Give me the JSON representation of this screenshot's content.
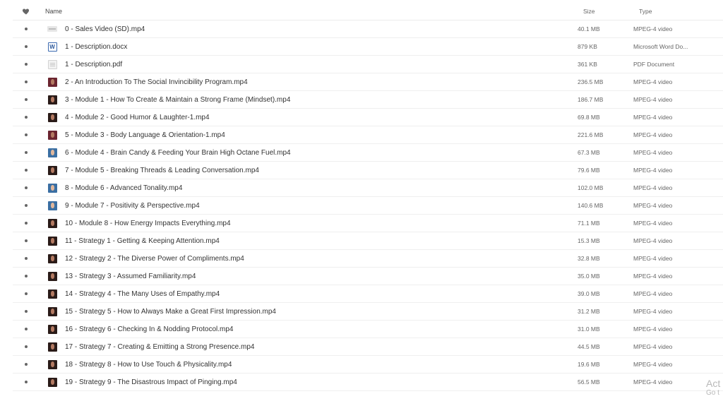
{
  "header": {
    "favorite_icon": "heart-icon",
    "name_label": "Name",
    "sort_icon": "chevron-up-icon",
    "size_label": "Size",
    "type_label": "Type"
  },
  "files": [
    {
      "name": "0 - Sales Video (SD).mp4",
      "size": "40.1 MB",
      "type": "MPEG-4 video",
      "thumb": "video-sd"
    },
    {
      "name": "1 - Description.docx",
      "size": "879 KB",
      "type": "Microsoft Word Do...",
      "thumb": "word"
    },
    {
      "name": "1 - Description.pdf",
      "size": "361 KB",
      "type": "PDF Document",
      "thumb": "pdf"
    },
    {
      "name": "2 - An Introduction To The Social Invincibility Program.mp4",
      "size": "236.5 MB",
      "type": "MPEG-4 video",
      "thumb": "red"
    },
    {
      "name": "3 - Module 1 - How To Create & Maintain a Strong Frame (Mindset).mp4",
      "size": "186.7 MB",
      "type": "MPEG-4 video",
      "thumb": "dark"
    },
    {
      "name": "4 - Module 2 - Good Humor & Laughter-1.mp4",
      "size": "69.8 MB",
      "type": "MPEG-4 video",
      "thumb": "dark"
    },
    {
      "name": "5 - Module 3 - Body Language & Orientation-1.mp4",
      "size": "221.6 MB",
      "type": "MPEG-4 video",
      "thumb": "red"
    },
    {
      "name": "6 - Module 4 - Brain Candy & Feeding Your Brain High Octane Fuel.mp4",
      "size": "67.3 MB",
      "type": "MPEG-4 video",
      "thumb": "blue"
    },
    {
      "name": "7 - Module 5 - Breaking Threads & Leading Conversation.mp4",
      "size": "79.6 MB",
      "type": "MPEG-4 video",
      "thumb": "dark"
    },
    {
      "name": "8 - Module 6 - Advanced Tonality.mp4",
      "size": "102.0 MB",
      "type": "MPEG-4 video",
      "thumb": "blue"
    },
    {
      "name": "9 - Module 7 - Positivity & Perspective.mp4",
      "size": "140.6 MB",
      "type": "MPEG-4 video",
      "thumb": "blue"
    },
    {
      "name": "10 - Module 8 - How Energy Impacts Everything.mp4",
      "size": "71.1 MB",
      "type": "MPEG-4 video",
      "thumb": "dark"
    },
    {
      "name": "11 - Strategy 1 - Getting & Keeping Attention.mp4",
      "size": "15.3 MB",
      "type": "MPEG-4 video",
      "thumb": "dark"
    },
    {
      "name": "12 - Strategy 2 - The Diverse Power of Compliments.mp4",
      "size": "32.8 MB",
      "type": "MPEG-4 video",
      "thumb": "dark"
    },
    {
      "name": "13 - Strategy 3 - Assumed Familiarity.mp4",
      "size": "35.0 MB",
      "type": "MPEG-4 video",
      "thumb": "dark"
    },
    {
      "name": "14 - Strategy 4 - The Many Uses of Empathy.mp4",
      "size": "39.0 MB",
      "type": "MPEG-4 video",
      "thumb": "dark"
    },
    {
      "name": "15 - Strategy 5 - How to Always Make a Great First Impression.mp4",
      "size": "31.2 MB",
      "type": "MPEG-4 video",
      "thumb": "dark"
    },
    {
      "name": "16 - Strategy 6 - Checking In & Nodding Protocol.mp4",
      "size": "31.0 MB",
      "type": "MPEG-4 video",
      "thumb": "dark"
    },
    {
      "name": "17 - Strategy 7 - Creating & Emitting a Strong Presence.mp4",
      "size": "44.5 MB",
      "type": "MPEG-4 video",
      "thumb": "dark"
    },
    {
      "name": "18 - Strategy 8 - How to Use Touch & Physicality.mp4",
      "size": "19.6 MB",
      "type": "MPEG-4 video",
      "thumb": "dark"
    },
    {
      "name": "19 - Strategy 9 - The Disastrous Impact of Pinging.mp4",
      "size": "56.5 MB",
      "type": "MPEG-4 video",
      "thumb": "dark"
    }
  ],
  "watermark": {
    "line1": "Act",
    "line2": "Go t"
  }
}
